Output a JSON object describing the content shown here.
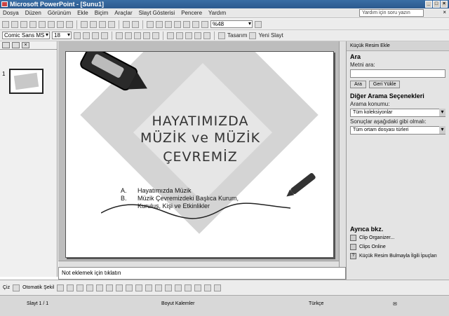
{
  "window": {
    "title": "Microsoft PowerPoint - [Sunu1]"
  },
  "menu": {
    "items": [
      "Dosya",
      "Düzen",
      "Görünüm",
      "Ekle",
      "Biçim",
      "Araçlar",
      "Slayt Gösterisi",
      "Pencere",
      "Yardım"
    ],
    "help_placeholder": "Yardım için soru yazın"
  },
  "standard_toolbar": {
    "zoom": "%48"
  },
  "format_toolbar": {
    "font": "Comic Sans MS",
    "size": "18",
    "design_label": "Tasarım",
    "new_slide_label": "Yeni Slayt"
  },
  "left_pane": {
    "slide_number": "1"
  },
  "slide": {
    "title_lines": [
      "HAYATIMIZDA",
      "MÜZİK ve MÜZİK",
      "ÇEVREMİZ"
    ],
    "bullets": [
      {
        "letter": "A.",
        "text": "Hayatımızda Müzik"
      },
      {
        "letter": "B.",
        "text": "Müzik Çevremizdeki Başlıca Kurum, Kuruluş, Kişi ve Etkinlikler"
      }
    ]
  },
  "notes": {
    "placeholder": "Not eklemek için tıklatın"
  },
  "task_pane": {
    "header": "Küçük Resim Ekle",
    "search_section": "Ara",
    "search_label": "Metni ara:",
    "search_button": "Ara",
    "restore_button": "Geri Yükle",
    "other_options": "Diğer Arama Seçenekleri",
    "search_in_label": "Arama konumu:",
    "search_in_value": "Tüm koleksiyonlar",
    "results_label": "Sonuçlar aşağıdaki gibi olmalı:",
    "results_value": "Tüm ortam dosyası türleri",
    "see_also": "Ayrıca bkz.",
    "links": [
      "Clip Organizer...",
      "Clips Online",
      "Küçük Resim Bulmayla İlgili İpuçları"
    ]
  },
  "drawing_toolbar": {
    "draw_label": "Çiz",
    "autoshapes_label": "Otomatik Şekil"
  },
  "status_bar": {
    "slide": "Slayt 1 / 1",
    "design": "Boyut Kalemler",
    "language": "Türkçe"
  }
}
